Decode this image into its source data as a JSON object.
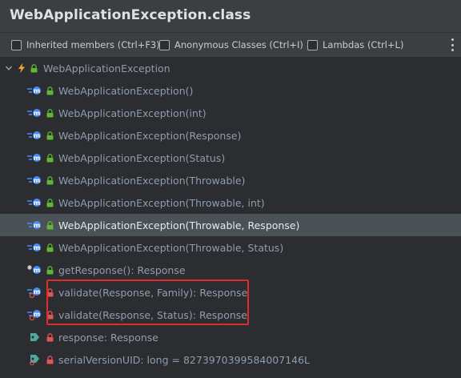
{
  "window": {
    "title": "WebApplicationException.class"
  },
  "filters": [
    {
      "label": "Inherited members (Ctrl+F3)",
      "checked": false
    },
    {
      "label": "Anonymous Classes (Ctrl+I)",
      "checked": false
    },
    {
      "label": "Lambdas (Ctrl+L)",
      "checked": false
    }
  ],
  "tree": {
    "root": {
      "label": "WebApplicationException"
    },
    "items": [
      {
        "label": "WebApplicationException()",
        "kind": "constructor"
      },
      {
        "label": "WebApplicationException(int)",
        "kind": "constructor"
      },
      {
        "label": "WebApplicationException(Response)",
        "kind": "constructor"
      },
      {
        "label": "WebApplicationException(Status)",
        "kind": "constructor"
      },
      {
        "label": "WebApplicationException(Throwable)",
        "kind": "constructor"
      },
      {
        "label": "WebApplicationException(Throwable, int)",
        "kind": "constructor"
      },
      {
        "label": "WebApplicationException(Throwable, Response)",
        "kind": "constructor",
        "selected": true
      },
      {
        "label": "WebApplicationException(Throwable, Status)",
        "kind": "constructor"
      },
      {
        "label": "getResponse(): Response",
        "kind": "method"
      },
      {
        "label": "validate(Response, Family): Response",
        "kind": "static-method"
      },
      {
        "label": "validate(Response, Status): Response",
        "kind": "static-method"
      },
      {
        "label": "response: Response",
        "kind": "field"
      },
      {
        "label": "serialVersionUID: long = 8273970399584007146L",
        "kind": "static-field"
      }
    ]
  },
  "colors": {
    "background": "#2b2d30",
    "toolbar": "#3c3f41",
    "selected": "#4a5157",
    "method_blue": "#4a8cf7",
    "lock_green": "#5fb832",
    "lock_red": "#e05555",
    "field_teal": "#52a8a0",
    "highlight_red": "#e12a2a"
  }
}
